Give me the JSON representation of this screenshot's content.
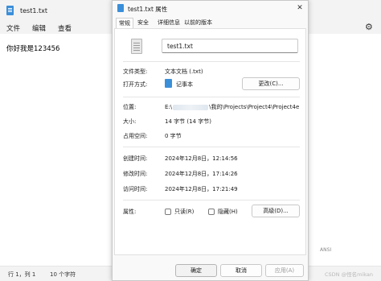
{
  "notepad": {
    "title": "test1.txt",
    "menu": [
      "文件",
      "编辑",
      "查看"
    ],
    "content": "你好我是123456",
    "status": {
      "position": "行 1，列 1",
      "chars": "10 个字符",
      "encoding": "ANSI"
    },
    "watermark": "CSDN @怪名mikan"
  },
  "dialog": {
    "title": "test1.txt 属性",
    "close_glyph": "✕",
    "tabs": [
      "常规",
      "安全",
      "详细信息",
      "以前的版本"
    ],
    "active_tab": "常规",
    "file_name": "test1.txt",
    "fields": {
      "type_label": "文件类型:",
      "type_value": "文本文档 (.txt)",
      "opens_label": "打开方式:",
      "opens_value": "记事本",
      "change_button": "更改(C)...",
      "location_label": "位置:",
      "location_prefix": "E:\\",
      "location_suffix": "\\我的\\Projects\\Project4\\Project4e",
      "size_label": "大小:",
      "size_value": "14 字节 (14 字节)",
      "disk_label": "占用空间:",
      "disk_value": "0 字节",
      "created_label": "创建时间:",
      "created_value": "2024年12月8日，12:14:56",
      "modified_label": "修改时间:",
      "modified_value": "2024年12月8日，17:14:26",
      "accessed_label": "访问时间:",
      "accessed_value": "2024年12月8日，17:21:49",
      "attr_label": "属性:",
      "readonly_label": "只读(R)",
      "hidden_label": "隐藏(H)",
      "advanced_button": "高级(D)..."
    },
    "buttons": {
      "ok": "确定",
      "cancel": "取消",
      "apply": "应用(A)"
    }
  }
}
